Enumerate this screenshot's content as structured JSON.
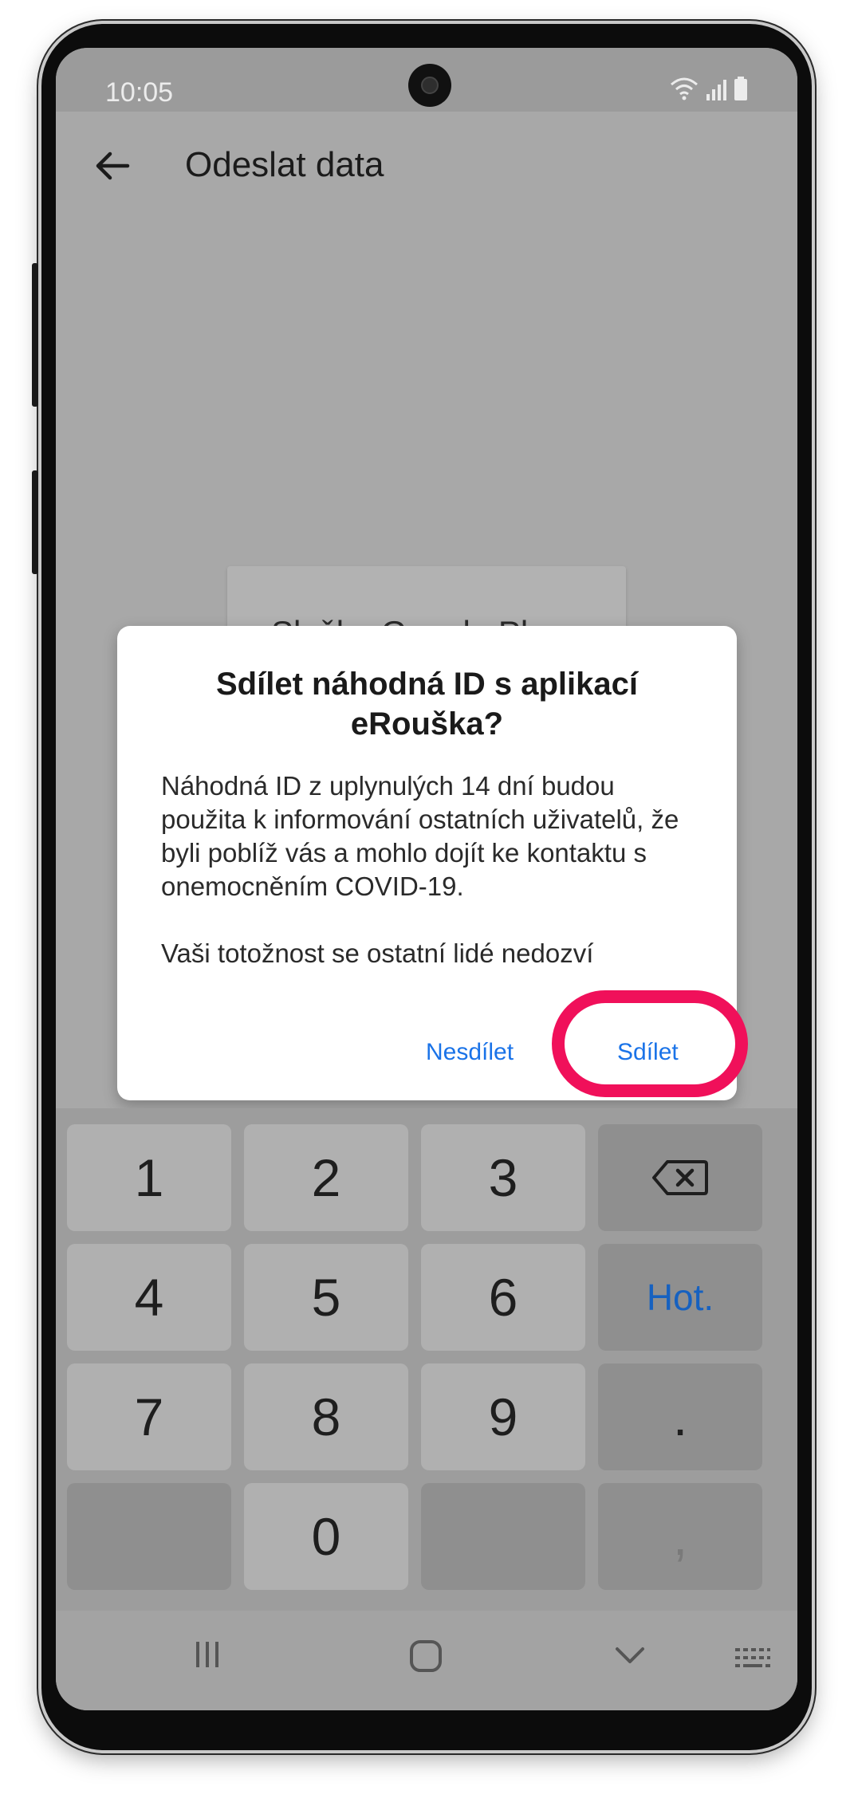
{
  "status_bar": {
    "time": "10:05"
  },
  "app_bar": {
    "title": "Odeslat data"
  },
  "background_card": {
    "title": "Služby Google Play"
  },
  "dialog": {
    "title": "Sdílet náhodná ID s aplikací eRouška?",
    "body": "Náhodná ID z uplynulých 14 dní budou použita k informování ostatních uživatelů, že byli poblíž vás a mohlo dojít ke kontaktu s onemocněním COVID-19.\n\nVaši totožnost se ostatní lidé nedozví",
    "decline_label": "Nesdílet",
    "accept_label": "Sdílet",
    "accent_color": "#1a73e8",
    "highlight_color": "#f0105a"
  },
  "keypad": {
    "keys": [
      "1",
      "2",
      "3",
      "",
      "4",
      "5",
      "6",
      "Hot.",
      "7",
      "8",
      "9",
      ".",
      "",
      "0",
      "",
      ","
    ]
  }
}
